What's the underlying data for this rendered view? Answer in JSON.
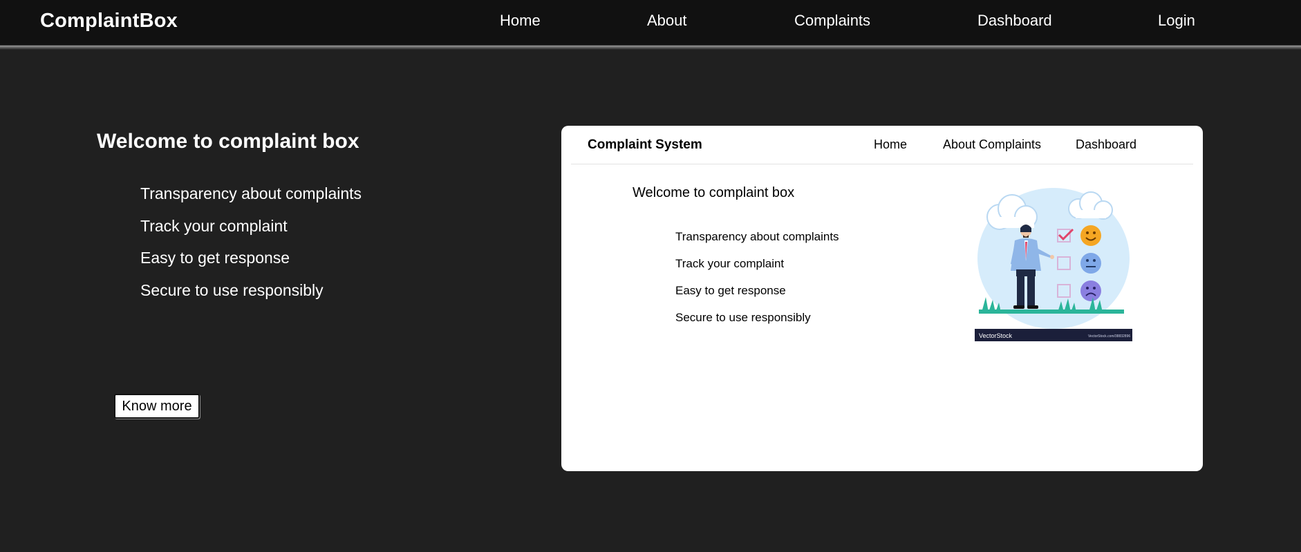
{
  "navbar": {
    "brand": "ComplaintBox",
    "links": [
      "Home",
      "About",
      "Complaints",
      "Dashboard",
      "Login"
    ]
  },
  "hero": {
    "title": "Welcome to complaint box",
    "features": [
      "Transparency about complaints",
      "Track your complaint",
      "Easy to get response",
      "Secure to use responsibly"
    ],
    "button_label": "Know more"
  },
  "preview": {
    "brand": "Complaint System",
    "links": [
      "Home",
      "About",
      "Complaints",
      "Dashboard"
    ],
    "title": "Welcome to complaint box",
    "features": [
      "Transparency about complaints",
      "Track your complaint",
      "Easy to get response",
      "Secure to use responsibly"
    ],
    "image_watermark": "VectorStock",
    "image_watermark_small": "VectorStock.com/38832896",
    "icons": [
      "cloud-icon",
      "businessman-icon",
      "happy-face-icon",
      "neutral-face-icon",
      "sad-face-icon",
      "checkbox-icon",
      "grass-icon"
    ]
  },
  "colors": {
    "page_bg": "#202020",
    "navbar_bg": "#111111",
    "preview_bg": "#ffffff",
    "happy": "#f5a623",
    "neutral": "#7fa8e8",
    "sad": "#8a7fe0",
    "check": "#e0456a",
    "grass": "#2bb59a"
  }
}
